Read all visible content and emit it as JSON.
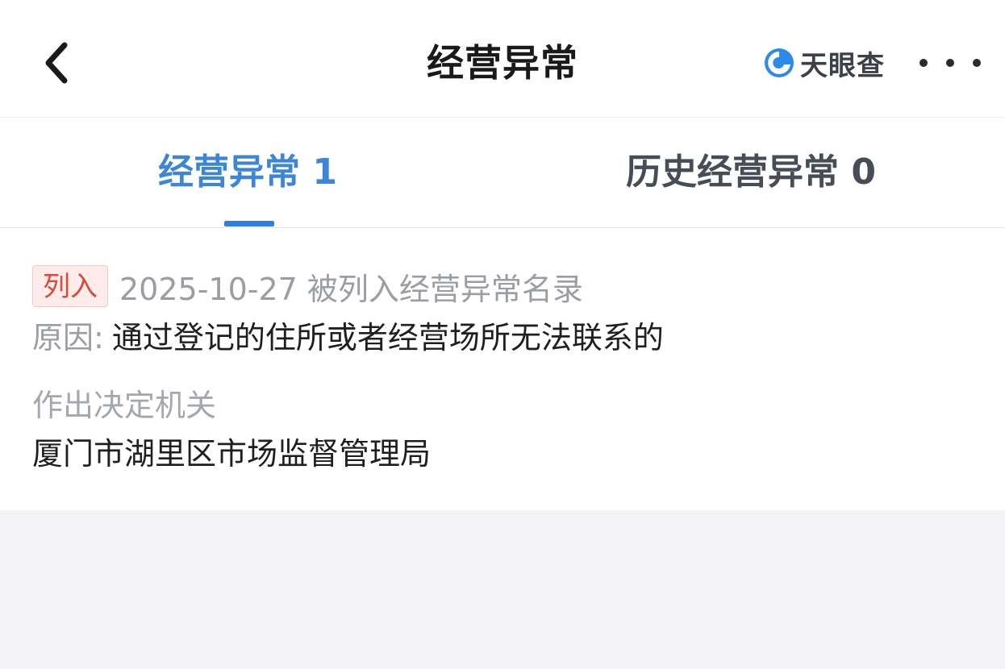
{
  "header": {
    "title": "经营异常",
    "brand_name": "天眼查",
    "back_icon": "chevron-left-icon",
    "brand_icon": "tianyancha-logo-icon",
    "more_icon": "more-dots-icon"
  },
  "tabs": [
    {
      "label": "经营异常 1",
      "active": true
    },
    {
      "label": "历史经营异常 0",
      "active": false
    }
  ],
  "record": {
    "badge": "列入",
    "date_line": "2025-10-27 被列入经营异常名录",
    "reason_label": "原因:",
    "reason_value": "通过登记的住所或者经营场所无法联系的",
    "authority_label": "作出决定机关",
    "authority_value": "厦门市湖里区市场监督管理局"
  },
  "colors": {
    "accent": "#3d86d6",
    "badge_text": "#d84a3d",
    "badge_bg": "#fdecea",
    "muted_text": "#9a9da4",
    "page_bg": "#f3f3f5"
  }
}
